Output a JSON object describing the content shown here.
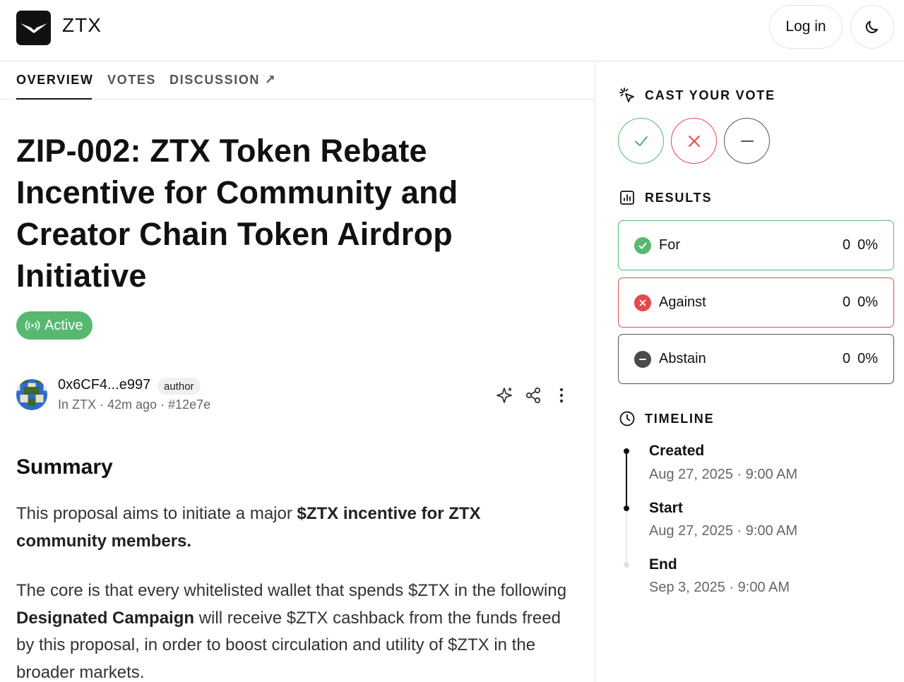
{
  "header": {
    "brand": "ZTX",
    "login_label": "Log in",
    "logo_icon": "ztx-logo-icon",
    "theme_icon": "moon-icon"
  },
  "tabs": [
    {
      "label": "OVERVIEW",
      "active": true
    },
    {
      "label": "VOTES",
      "active": false
    },
    {
      "label": "DISCUSSION ↗",
      "active": false
    }
  ],
  "proposal": {
    "title": "ZIP-002: ZTX Token Rebate Incentive for Community and Creator Chain Token Airdrop Initiative",
    "status": "Active",
    "status_color": "#57b970",
    "author": {
      "address": "0x6CF4...e997",
      "tag": "author",
      "meta": "In ZTX · 42m ago · #12e7e"
    }
  },
  "body": {
    "summary_heading": "Summary",
    "p1_pre": "This proposal aims to initiate a major ",
    "p1_bold": "$ZTX incentive for ZTX community members.",
    "p2_pre": "The core is that every whitelisted wallet that spends $ZTX in the following ",
    "p2_bold": "Designated Campaign",
    "p2_post": " will receive $ZTX cashback from the funds freed by this proposal, in order to boost circulation and utility of $ZTX in the broader markets."
  },
  "vote": {
    "heading": "CAST YOUR VOTE",
    "buttons": [
      "check-icon",
      "x-icon",
      "minus-icon"
    ],
    "colors": {
      "for": "#4caf6a",
      "against": "#e5484d",
      "abstain": "#555555"
    }
  },
  "results": {
    "heading": "RESULTS",
    "items": [
      {
        "label": "For",
        "count": "0",
        "percent": "0%"
      },
      {
        "label": "Against",
        "count": "0",
        "percent": "0%"
      },
      {
        "label": "Abstain",
        "count": "0",
        "percent": "0%"
      }
    ]
  },
  "timeline": {
    "heading": "TIMELINE",
    "items": [
      {
        "title": "Created",
        "date": "Aug 27, 2025 · 9:00 AM"
      },
      {
        "title": "Start",
        "date": "Aug 27, 2025 · 9:00 AM"
      },
      {
        "title": "End",
        "date": "Sep 3, 2025 · 9:00 AM"
      }
    ]
  }
}
